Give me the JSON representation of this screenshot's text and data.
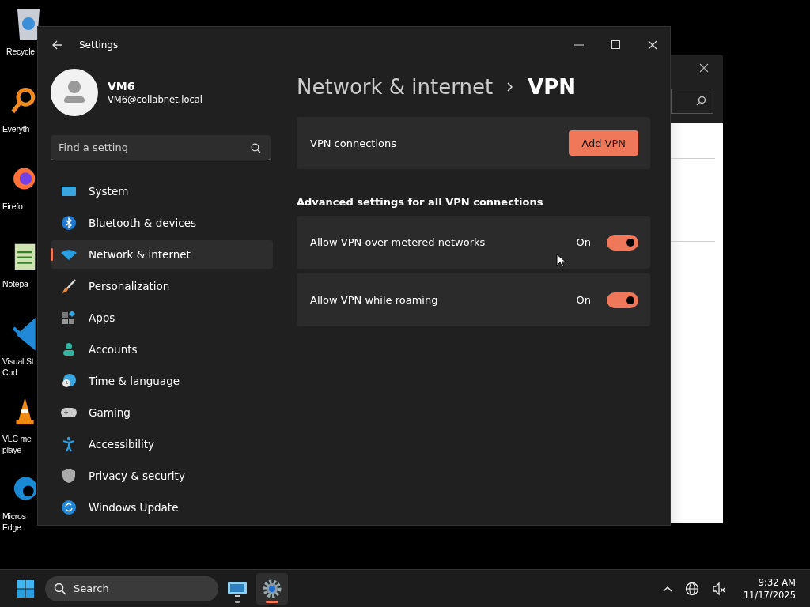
{
  "desktop_icons": [
    {
      "kind": "recycle",
      "lines": [
        "Recycle"
      ]
    },
    {
      "kind": "magnifier",
      "lines": [
        "Everyth"
      ]
    },
    {
      "kind": "browser",
      "lines": [
        "Firefo"
      ]
    },
    {
      "kind": "notepad",
      "lines": [
        "Notepa"
      ]
    },
    {
      "kind": "code",
      "lines": [
        "Visual St",
        "Cod"
      ]
    },
    {
      "kind": "cone",
      "lines": [
        "VLC me",
        "playe"
      ]
    },
    {
      "kind": "edge",
      "lines": [
        "Micros",
        "Edge"
      ]
    }
  ],
  "window": {
    "title": "Settings"
  },
  "user": {
    "name": "VM6",
    "email": "VM6@collabnet.local"
  },
  "search": {
    "placeholder": "Find a setting"
  },
  "sidebar": {
    "items": [
      {
        "label": "System",
        "selected": false
      },
      {
        "label": "Bluetooth & devices",
        "selected": false
      },
      {
        "label": "Network & internet",
        "selected": true
      },
      {
        "label": "Personalization",
        "selected": false
      },
      {
        "label": "Apps",
        "selected": false
      },
      {
        "label": "Accounts",
        "selected": false
      },
      {
        "label": "Time & language",
        "selected": false
      },
      {
        "label": "Gaming",
        "selected": false
      },
      {
        "label": "Accessibility",
        "selected": false
      },
      {
        "label": "Privacy & security",
        "selected": false
      },
      {
        "label": "Windows Update",
        "selected": false
      }
    ]
  },
  "breadcrumb": {
    "parent": "Network & internet",
    "current": "VPN"
  },
  "vpn_card": {
    "label": "VPN connections",
    "button": "Add VPN"
  },
  "advanced": {
    "heading": "Advanced settings for all VPN connections",
    "rows": [
      {
        "label": "Allow VPN over metered networks",
        "state_text": "On",
        "on": true
      },
      {
        "label": "Allow VPN while roaming",
        "state_text": "On",
        "on": true
      }
    ]
  },
  "taskbar": {
    "search_placeholder": "Search",
    "apps": [
      {
        "kind": "monitor",
        "selected": false
      },
      {
        "kind": "gear",
        "selected": true
      }
    ],
    "time": "9:32 AM",
    "date": "11/17/2025"
  }
}
